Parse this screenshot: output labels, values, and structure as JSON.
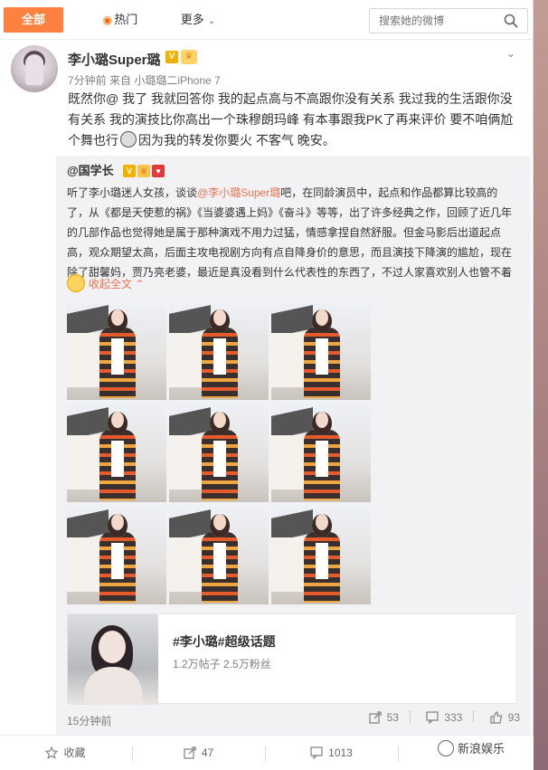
{
  "tabs": {
    "all": "全部",
    "hot": "热门",
    "more": "更多"
  },
  "search": {
    "placeholder": "搜索她的微博"
  },
  "post": {
    "author": "李小璐Super璐",
    "meta": "7分钟前 来自 小璐璐二iPhone 7",
    "text_a": "既然你@ 我了 我就回答你 我的起点高与不高跟你没有关系 我过我的生活跟你没有关系 我的演技比你高出一个珠穆朗玛峰 有本事跟我PK了再来评价 要不咱俩尬个舞也行",
    "text_b": "因为我的转发你要火 不客气 晚安。"
  },
  "repost": {
    "author": "@国学长",
    "text_a": "听了李小璐迷人女孩，谈谈",
    "mention": "@李小璐Super璐",
    "text_b": "吧，在同龄演员中，起点和作品都算比较高的了，从《都是天使惹的祸》《当婆婆遇上妈》《奋斗》等等，出了许多经典之作，回顾了近几年的几部作品也觉得她是属于那种演戏不用力过猛，情感拿捏自然舒服。但金马影后出道起点高，观众期望太高，后面主攻电视剧方向有点自降身价的意思，而且演技下降演的尴尬，现在除了甜馨妈，贾乃亮老婆，最近是真没看到什么代表性的东西了，不过人家喜欢别人也管不着",
    "collapse": "收起全文",
    "topic_title": "#李小璐#超级话题",
    "topic_stats": "1.2万帖子 2.5万粉丝",
    "time": "15分钟前",
    "forwards": "53",
    "comments": "333",
    "likes": "93"
  },
  "bottom": {
    "favorite": "收藏",
    "forward": "47",
    "comment": "1013"
  },
  "watermark": "新浪娱乐",
  "colors": {
    "accent": "#ff8140",
    "link": "#eb7350"
  }
}
